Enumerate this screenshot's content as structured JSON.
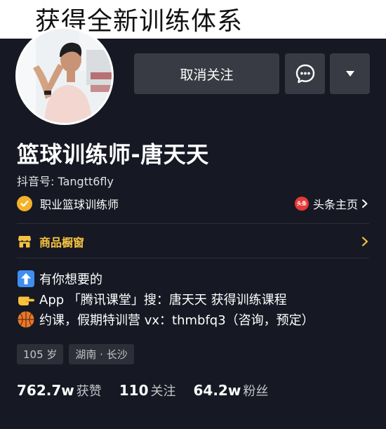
{
  "banner": {
    "text": "获得全新训练体系"
  },
  "actions": {
    "unfollow_label": "取消关注"
  },
  "profile": {
    "name": "篮球训练师-唐天天",
    "douyin_id": "抖音号: Tangtt6fly",
    "verified_title": "职业篮球训练师",
    "toutiao_logo": "头条",
    "toutiao_label": "头条主页"
  },
  "shop": {
    "label": "商品橱窗"
  },
  "bio": {
    "line1": "有你想要的",
    "line2": "App 「腾讯课堂」搜：唐天天  获得训练课程",
    "line3": "约课，假期特训营 vx：thmbfq3（咨询，预定）"
  },
  "tags": {
    "age": "105 岁",
    "location": "湖南 · 长沙"
  },
  "stats": {
    "likes_value": "762.7w",
    "likes_label": "获赞",
    "following_value": "110",
    "following_label": "关注",
    "followers_value": "64.2w",
    "followers_label": "粉丝"
  },
  "icons": [
    "chat-bubble-icon",
    "caret-down-icon",
    "verified-check-icon",
    "toutiao-logo-icon",
    "chevron-right-icon",
    "shop-icon",
    "up-arrow-emoji",
    "pointing-hand-emoji",
    "basketball-emoji"
  ],
  "colors": {
    "background": "#161823",
    "button": "#393b44",
    "verified_badge": "#f5b12a",
    "shop_accent": "#f5c242",
    "toutiao_red": "#e53935",
    "secondary_text": "#c4c5c9"
  }
}
